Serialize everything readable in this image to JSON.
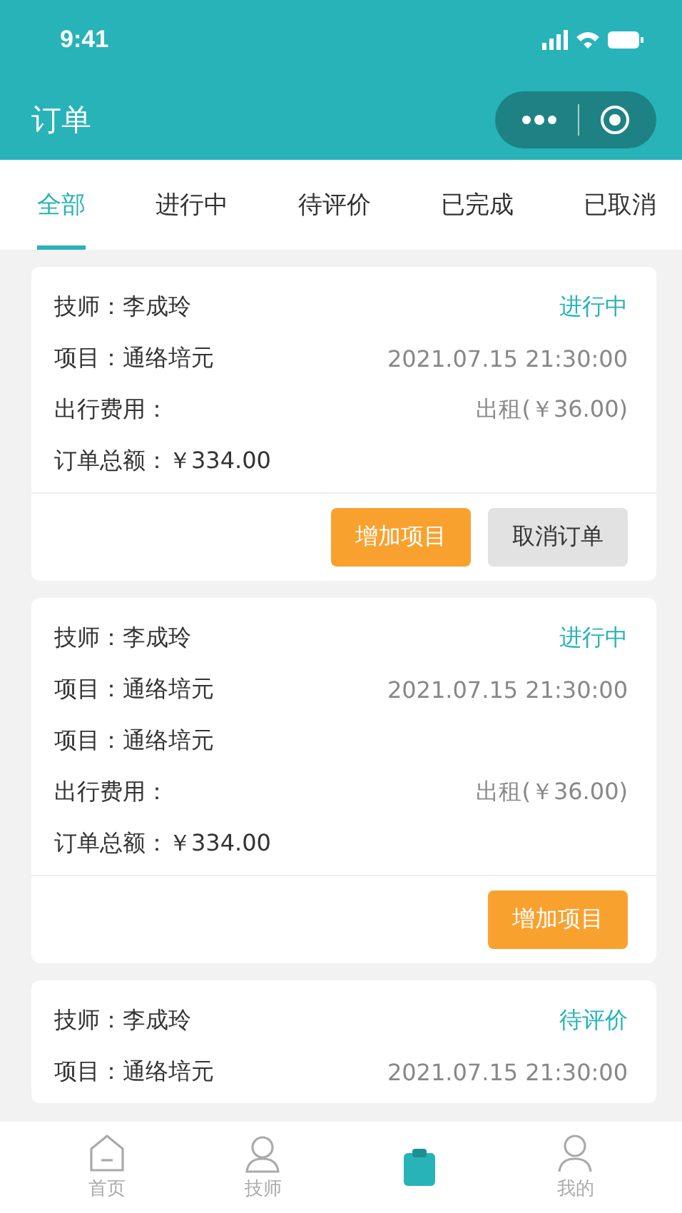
{
  "status_bar": {
    "time": "9:41"
  },
  "nav_bar": {
    "title": "订单"
  },
  "tabs": [
    {
      "label": "全部",
      "selected": true
    },
    {
      "label": "进行中",
      "selected": false
    },
    {
      "label": "待评价",
      "selected": false
    },
    {
      "label": "已完成",
      "selected": false
    },
    {
      "label": "已取消",
      "selected": false
    }
  ],
  "orders": [
    {
      "rows": [
        {
          "left": "技师：李成玲",
          "right": "进行中",
          "kind": "status"
        },
        {
          "left": "项目：通络培元",
          "right": "2021.07.15 21:30:00",
          "kind": "info"
        },
        {
          "left": "出行费用：",
          "right": "出租(￥36.00)",
          "kind": "info"
        },
        {
          "left": "订单总额：￥334.00"
        }
      ],
      "actions": [
        {
          "label": "增加项目",
          "kind": "primary"
        },
        {
          "label": "取消订单",
          "kind": "secondary"
        }
      ]
    },
    {
      "rows": [
        {
          "left": "技师：李成玲",
          "right": "进行中",
          "kind": "status"
        },
        {
          "left": "项目：通络培元",
          "right": "2021.07.15 21:30:00",
          "kind": "info"
        },
        {
          "left": "项目：通络培元"
        },
        {
          "left": "出行费用：",
          "right": "出租(￥36.00)",
          "kind": "info"
        },
        {
          "left": "订单总额：￥334.00"
        }
      ],
      "actions": [
        {
          "label": "增加项目",
          "kind": "primary"
        }
      ]
    },
    {
      "rows": [
        {
          "left": "技师：李成玲",
          "right": "待评价",
          "kind": "status"
        },
        {
          "left": "项目：通络培元",
          "right": "2021.07.15 21:30:00",
          "kind": "info"
        }
      ]
    }
  ],
  "tab_bar": [
    {
      "label": "首页",
      "kind": "home",
      "selected": false
    },
    {
      "label": "技师",
      "kind": "person",
      "selected": false
    },
    {
      "kind": "clipboard",
      "selected": true
    },
    {
      "label": "我的",
      "kind": "user",
      "selected": false
    }
  ]
}
